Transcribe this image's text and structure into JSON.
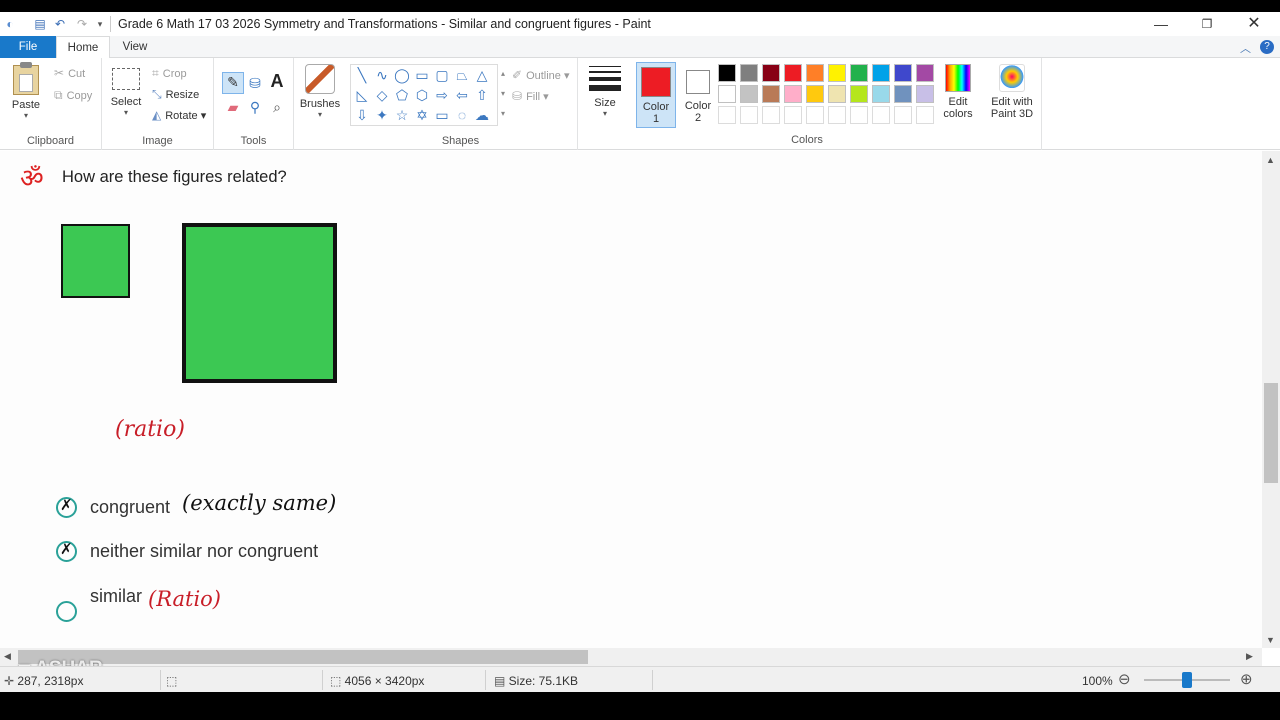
{
  "window": {
    "title": "Grade 6 Math 17 03 2026 Symmetry and Transformations - Similar and congruent figures - Paint"
  },
  "menu": {
    "file": "File",
    "home": "Home",
    "view": "View"
  },
  "ribbon": {
    "clipboard": {
      "paste": "Paste",
      "cut": "Cut",
      "copy": "Copy",
      "label": "Clipboard"
    },
    "image": {
      "select": "Select",
      "crop": "Crop",
      "resize": "Resize",
      "rotate": "Rotate",
      "label": "Image"
    },
    "tools": {
      "label": "Tools",
      "text_glyph": "A"
    },
    "brushes": {
      "label": "Brushes"
    },
    "shapes": {
      "outline": "Outline",
      "fill": "Fill",
      "label": "Shapes"
    },
    "size": {
      "label": "Size"
    },
    "color1": {
      "label": "Color",
      "num": "1",
      "color": "#ed1c24"
    },
    "color2": {
      "label": "Color",
      "num": "2",
      "color": "#ffffff"
    },
    "colors": {
      "label": "Colors",
      "row1": [
        "#000000",
        "#7f7f7f",
        "#880015",
        "#ed1c24",
        "#ff7f27",
        "#fff200",
        "#22b14c",
        "#00a2e8",
        "#3f48cc",
        "#a349a4"
      ],
      "row2": [
        "#ffffff",
        "#c3c3c3",
        "#b97a57",
        "#ffaec9",
        "#ffc90e",
        "#efe4b0",
        "#b5e61d",
        "#99d9ea",
        "#7092be",
        "#c8bfe7"
      ],
      "row3": [
        "#ffffff",
        "#ffffff",
        "#ffffff",
        "#ffffff",
        "#ffffff",
        "#ffffff",
        "#ffffff",
        "#ffffff",
        "#ffffff",
        "#ffffff"
      ]
    },
    "edit_colors": {
      "line1": "Edit",
      "line2": "colors"
    },
    "paint3d": {
      "line1": "Edit with",
      "line2": "Paint 3D"
    }
  },
  "canvas": {
    "question": "How are these figures related?",
    "om_mark": "ॐ",
    "figures": {
      "fill_color": "#3cc853"
    },
    "annotation_ratio": "(ratio)",
    "options": [
      {
        "label": "congruent",
        "note": "(exactly same)"
      },
      {
        "label": "neither similar nor congruent",
        "note": ""
      },
      {
        "label": "similar",
        "note": "(Ratio)"
      }
    ],
    "watermark": "ASHAR"
  },
  "status": {
    "cursor_pos": "287, 2318px",
    "dimensions": "4056 × 3420px",
    "size": "Size: 75.1KB",
    "zoom": "100%",
    "zoom_level": 0.5
  }
}
